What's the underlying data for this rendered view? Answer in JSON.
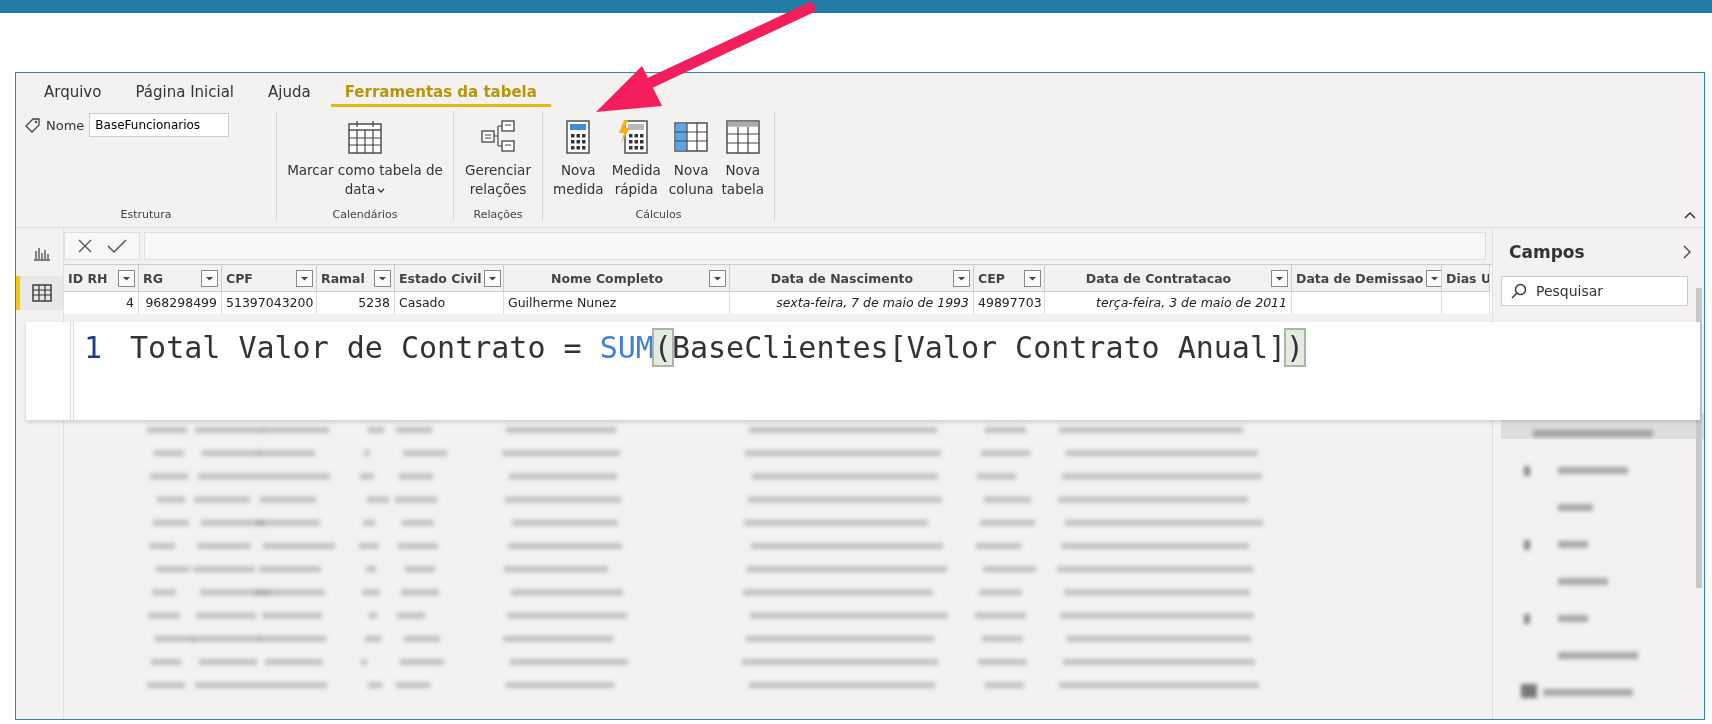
{
  "tabs": [
    {
      "label": "Arquivo",
      "selected": false
    },
    {
      "label": "Página Inicial",
      "selected": false
    },
    {
      "label": "Ajuda",
      "selected": false
    },
    {
      "label": "Ferramentas da tabela",
      "selected": true
    }
  ],
  "ribbon": {
    "name_label": "Nome",
    "name_value": "BaseFuncionarios",
    "groups": [
      {
        "title": "Estrutura"
      },
      {
        "title": "Calendários",
        "buttons": [
          {
            "kind": "calendar",
            "lines": [
              "Marcar como tabela de",
              "data"
            ],
            "dropdown": true
          }
        ]
      },
      {
        "title": "Relações",
        "buttons": [
          {
            "kind": "relations",
            "lines": [
              "Gerenciar",
              "relações"
            ],
            "dropdown": false
          }
        ]
      },
      {
        "title": "Cálculos",
        "buttons": [
          {
            "kind": "calculator",
            "lines": [
              "Nova",
              "medida"
            ],
            "dropdown": false
          },
          {
            "kind": "quick-measure",
            "lines": [
              "Medida",
              "rápida"
            ],
            "dropdown": false
          },
          {
            "kind": "column",
            "lines": [
              "Nova",
              "coluna"
            ],
            "dropdown": false
          },
          {
            "kind": "table",
            "lines": [
              "Nova",
              "tabela"
            ],
            "dropdown": false
          }
        ]
      }
    ]
  },
  "views": [
    {
      "kind": "report",
      "selected": false
    },
    {
      "kind": "data",
      "selected": true
    }
  ],
  "table": {
    "columns": [
      {
        "name": "ID RH",
        "kind": "number"
      },
      {
        "name": "RG",
        "kind": "number"
      },
      {
        "name": "CPF",
        "kind": "number"
      },
      {
        "name": "Ramal",
        "kind": "number"
      },
      {
        "name": "Estado Civil",
        "kind": "text"
      },
      {
        "name": "Nome Completo",
        "kind": "text"
      },
      {
        "name": "Data de Nascimento",
        "kind": "date"
      },
      {
        "name": "CEP",
        "kind": "number"
      },
      {
        "name": "Data de Contratacao",
        "kind": "date"
      },
      {
        "name": "Data de Demissao",
        "kind": "date"
      },
      {
        "name": "Dias U",
        "kind": "number"
      }
    ],
    "rows": [
      [
        "4",
        "968298499",
        "51397043200",
        "5238",
        "Casado",
        "Guilherme Nunez",
        "sexta-feira, 7 de maio de 1993",
        "49897703",
        "terça-feira, 3 de maio de 2011"
      ]
    ]
  },
  "fields_panel": {
    "title": "Campos",
    "search_placeholder": "Pesquisar"
  },
  "formula": {
    "line_number": "1",
    "tokens": [
      {
        "kind": "text",
        "text": "Total Valor de Contrato = "
      },
      {
        "kind": "function",
        "text": "SUM"
      },
      {
        "kind": "bracket-match",
        "text": "("
      },
      {
        "kind": "text",
        "text": "BaseClientes[Valor Contrato Anual]"
      },
      {
        "kind": "bracket-match",
        "text": ")"
      }
    ]
  }
}
